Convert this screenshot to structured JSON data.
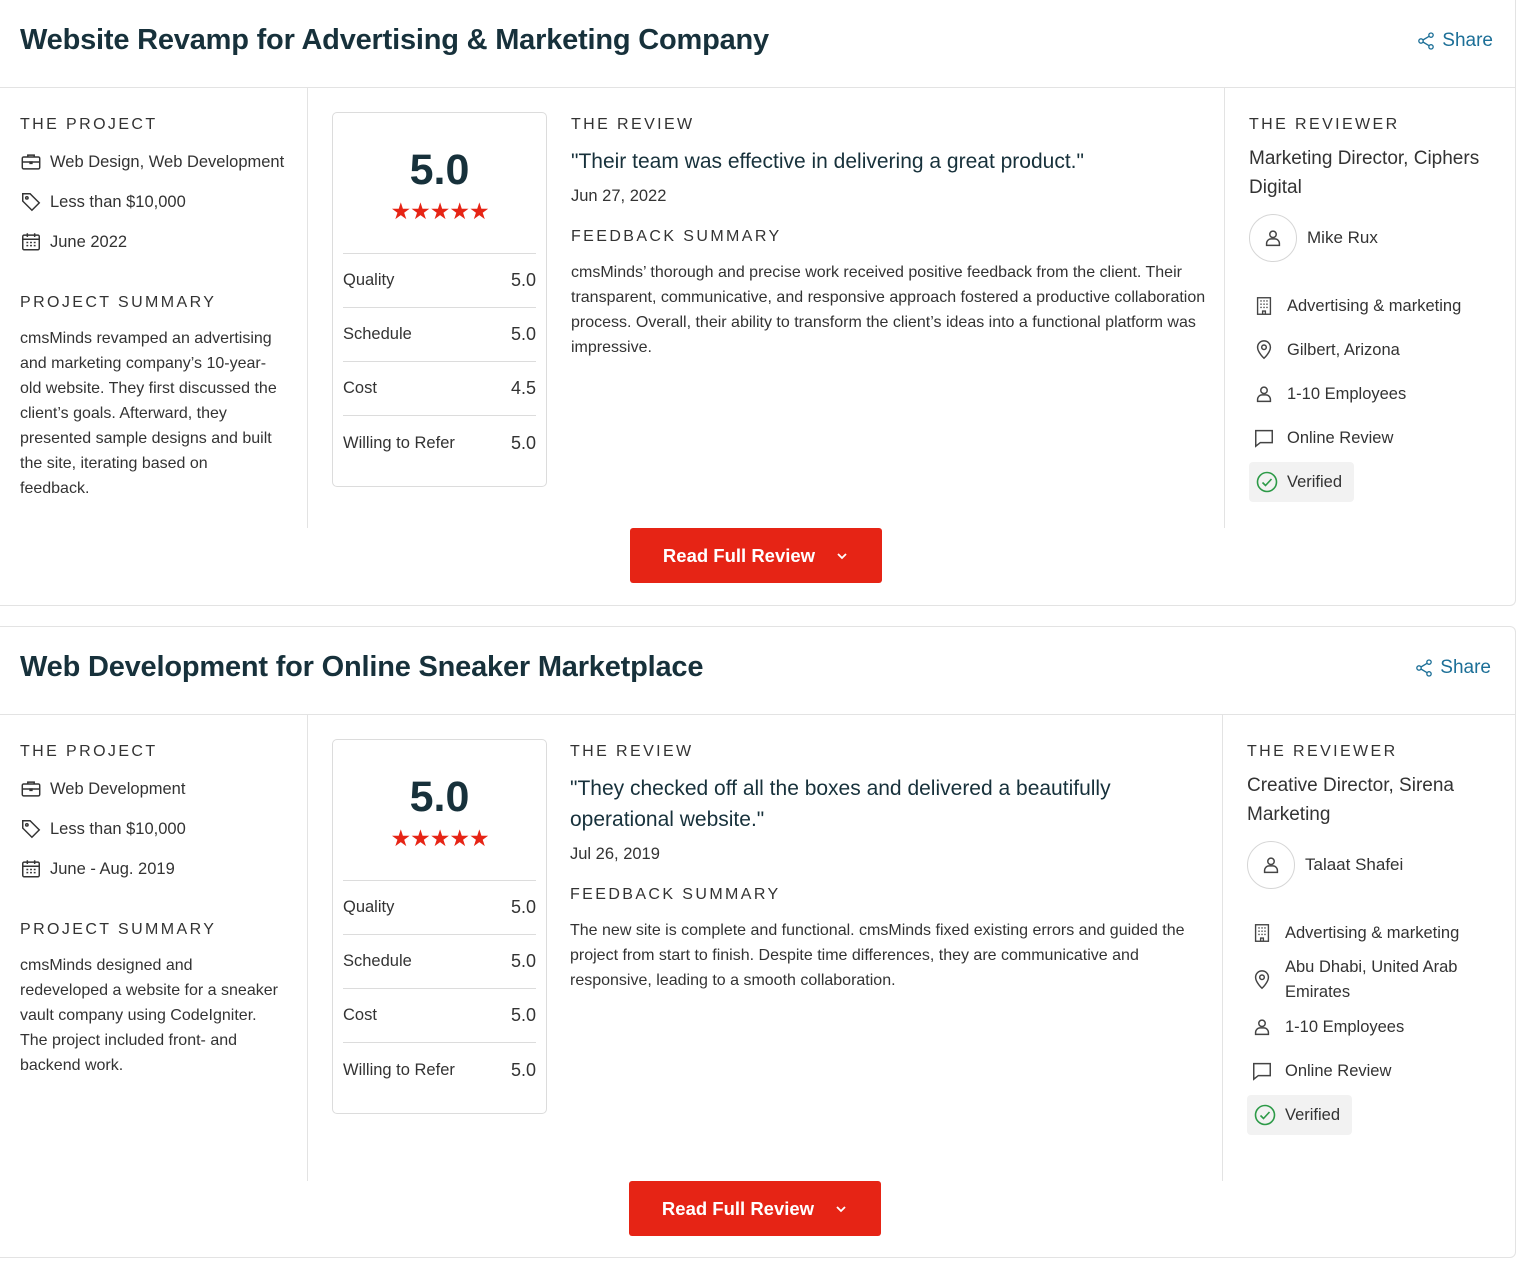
{
  "colors": {
    "accent_red": "#e62415",
    "title_navy": "#17313b",
    "link_blue": "#1c6f97",
    "verified_green": "#2c9a47"
  },
  "reviews": [
    {
      "title": "Website Revamp for Advertising & Marketing Company",
      "share_label": "Share",
      "project": {
        "label": "THE PROJECT",
        "services": "Web Design, Web Development",
        "budget": "Less than $10,000",
        "timeline": "June 2022",
        "summary_label": "PROJECT SUMMARY",
        "summary": "cmsMinds revamped an advertising and marketing company’s 10-year-old website. They first discussed the client’s goals. Afterward, they presented sample designs and built the site, iterating based on feedback."
      },
      "score": {
        "overall": "5.0",
        "stars": 5,
        "rows": [
          {
            "label": "Quality",
            "value": "5.0"
          },
          {
            "label": "Schedule",
            "value": "5.0"
          },
          {
            "label": "Cost",
            "value": "4.5"
          },
          {
            "label": "Willing to Refer",
            "value": "5.0"
          }
        ]
      },
      "review": {
        "label": "THE REVIEW",
        "quote": "\"Their team was effective in delivering a great product.\"",
        "date": "Jun 27, 2022",
        "feedback_label": "FEEDBACK SUMMARY",
        "feedback": "cmsMinds’ thorough and precise work received positive feedback from the client. Their transparent, communicative, and responsive approach fostered a productive collaboration process. Overall, their ability to transform the client’s ideas into a functional platform was impressive."
      },
      "reviewer": {
        "label": "THE REVIEWER",
        "role": "Marketing Director, Ciphers Digital",
        "name": "Mike Rux",
        "industry": "Advertising & marketing",
        "location": "Gilbert, Arizona",
        "size": "1-10 Employees",
        "review_type": "Online Review",
        "verified": "Verified"
      },
      "button_label": "Read Full Review"
    },
    {
      "title": "Web Development for Online Sneaker Marketplace",
      "share_label": "Share",
      "project": {
        "label": "THE PROJECT",
        "services": "Web Development",
        "budget": "Less than $10,000",
        "timeline": "June - Aug. 2019",
        "summary_label": "PROJECT SUMMARY",
        "summary": "cmsMinds designed and redeveloped a website for a sneaker vault company using CodeIgniter. The project included front- and backend work."
      },
      "score": {
        "overall": "5.0",
        "stars": 5,
        "rows": [
          {
            "label": "Quality",
            "value": "5.0"
          },
          {
            "label": "Schedule",
            "value": "5.0"
          },
          {
            "label": "Cost",
            "value": "5.0"
          },
          {
            "label": "Willing to Refer",
            "value": "5.0"
          }
        ]
      },
      "review": {
        "label": "THE REVIEW",
        "quote": "\"They checked off all the boxes and delivered a beautifully operational website.\"",
        "date": "Jul 26, 2019",
        "feedback_label": "FEEDBACK SUMMARY",
        "feedback": "The new site is complete and functional. cmsMinds fixed existing errors and guided the project from start to finish. Despite time differences, they are communicative and responsive, leading to a smooth collaboration."
      },
      "reviewer": {
        "label": "THE REVIEWER",
        "role": "Creative Director, Sirena Marketing",
        "name": "Talaat Shafei",
        "industry": "Advertising & marketing",
        "location": "Abu Dhabi, United Arab Emirates",
        "size": "1-10 Employees",
        "review_type": "Online Review",
        "verified": "Verified"
      },
      "button_label": "Read Full Review"
    }
  ]
}
